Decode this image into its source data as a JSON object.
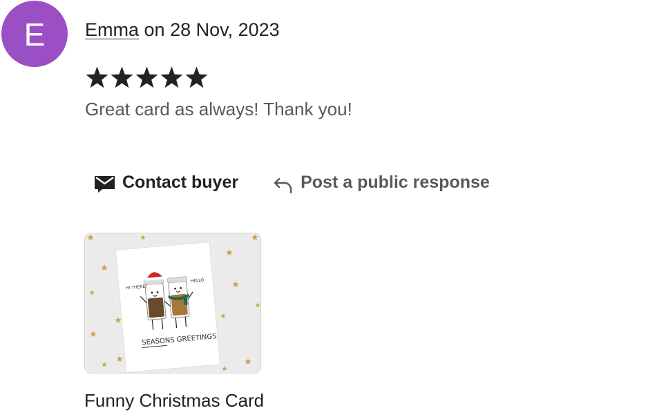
{
  "review": {
    "author_initial": "E",
    "author_name": "Emma",
    "date_prefix": " on ",
    "date": "28 Nov, 2023",
    "rating": 5,
    "rating_max": 5,
    "text": "Great card as always! Thank you!",
    "avatar_color": "#9b4fc4"
  },
  "actions": {
    "contact_label": "Contact buyer",
    "contact_icon": "envelope-icon",
    "public_label": "Post a public response",
    "public_icon": "reply-arrow-icon"
  },
  "listing": {
    "title": "Funny Christmas Card",
    "card_greeting_left": "HI THERE!",
    "card_greeting_right": "HELLO",
    "card_caption": "SEASONS GREETINGS"
  }
}
